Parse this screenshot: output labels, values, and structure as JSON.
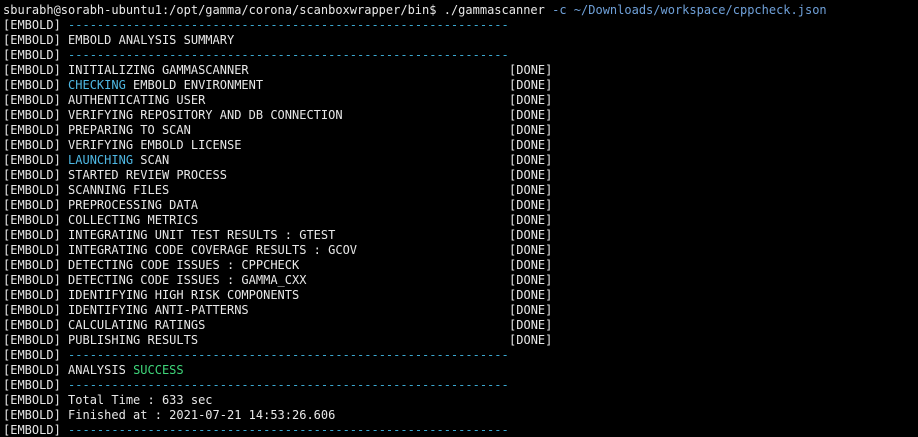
{
  "prompt": {
    "user_host": "sburabh@sorabh-ubuntu1:/opt/gamma/corona/scanboxwrapper/bin$",
    "command": "./gammascanner",
    "flag": "-c",
    "path": "~/Downloads/workspace/cppcheck.json"
  },
  "tag": "[EMBOLD]",
  "separator": "-------------------------------------------------------------",
  "summary_title": "EMBOLD ANALYSIS SUMMARY",
  "steps": [
    {
      "pre": "INITIALIZING GAMMASCANNER",
      "hl": "",
      "post": "",
      "status": "[DONE]"
    },
    {
      "pre": "",
      "hl": "CHECKING",
      "post": " EMBOLD ENVIRONMENT",
      "status": "[DONE]"
    },
    {
      "pre": "AUTHENTICATING USER",
      "hl": "",
      "post": "",
      "status": "[DONE]"
    },
    {
      "pre": "VERIFYING REPOSITORY AND DB CONNECTION",
      "hl": "",
      "post": "",
      "status": "[DONE]"
    },
    {
      "pre": "PREPARING TO SCAN",
      "hl": "",
      "post": "",
      "status": "[DONE]"
    },
    {
      "pre": "VERIFYING EMBOLD LICENSE",
      "hl": "",
      "post": "",
      "status": "[DONE]"
    },
    {
      "pre": "",
      "hl": "LAUNCHING",
      "post": " SCAN",
      "status": "[DONE]"
    },
    {
      "pre": "STARTED REVIEW PROCESS",
      "hl": "",
      "post": "",
      "status": "[DONE]"
    },
    {
      "pre": "SCANNING FILES",
      "hl": "",
      "post": "",
      "status": "[DONE]"
    },
    {
      "pre": "PREPROCESSING DATA",
      "hl": "",
      "post": "",
      "status": "[DONE]"
    },
    {
      "pre": "COLLECTING METRICS",
      "hl": "",
      "post": "",
      "status": "[DONE]"
    },
    {
      "pre": "INTEGRATING UNIT TEST RESULTS : GTEST",
      "hl": "",
      "post": "",
      "status": "[DONE]"
    },
    {
      "pre": "INTEGRATING CODE COVERAGE RESULTS : GCOV",
      "hl": "",
      "post": "",
      "status": "[DONE]"
    },
    {
      "pre": "DETECTING CODE ISSUES : CPPCHECK",
      "hl": "",
      "post": "",
      "status": "[DONE]"
    },
    {
      "pre": "DETECTING CODE ISSUES : GAMMA_CXX",
      "hl": "",
      "post": "",
      "status": "[DONE]"
    },
    {
      "pre": "IDENTIFYING HIGH RISK COMPONENTS",
      "hl": "",
      "post": "",
      "status": "[DONE]"
    },
    {
      "pre": "IDENTIFYING ANTI-PATTERNS",
      "hl": "",
      "post": "",
      "status": "[DONE]"
    },
    {
      "pre": "CALCULATING RATINGS",
      "hl": "",
      "post": "",
      "status": "[DONE]"
    },
    {
      "pre": "PUBLISHING RESULTS",
      "hl": "",
      "post": "",
      "status": "[DONE]"
    }
  ],
  "analysis": {
    "label": "ANALYSIS",
    "result": "SUCCESS"
  },
  "total_time": "Total Time : 633 sec",
  "finished_at": "Finished at : 2021-07-21 14:53:26.606",
  "colors": {
    "background": "#000000",
    "text": "#e8e8e8",
    "separator": "#3aa7cf",
    "highlight_cyan": "#4fb8e3",
    "success_green": "#3fd67a"
  }
}
